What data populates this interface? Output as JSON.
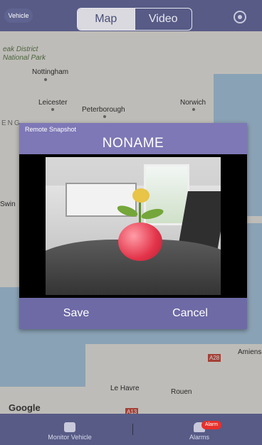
{
  "header": {
    "vehicle_label": "Vehicle",
    "tabs": [
      {
        "label": "Map",
        "active": true
      },
      {
        "label": "Video",
        "active": false
      }
    ],
    "settings_icon": "gear-icon"
  },
  "map": {
    "labels": [
      "eak District",
      "National Park",
      "Nottingham",
      "Leicester",
      "Peterborough",
      "Norwich",
      "ENG",
      "Swin",
      "Le Havre",
      "Rouen",
      "Amiens",
      "A28",
      "A13"
    ],
    "attribution": "Google"
  },
  "modal": {
    "subtitle": "Remote Snapshot",
    "title": "NONAME",
    "buttons": {
      "save": "Save",
      "cancel": "Cancel"
    }
  },
  "bottom_nav": {
    "items": [
      {
        "label": "Monitor Vehicle",
        "icon": "car-icon"
      },
      {
        "label": "Alarms",
        "icon": "bell-icon"
      }
    ],
    "alarm_badge": "Alarm"
  },
  "colors": {
    "bar": "#575b86",
    "modal_header": "#7e78b6",
    "modal_footer": "#6e6aa6",
    "alarm_badge": "#e8302b"
  }
}
